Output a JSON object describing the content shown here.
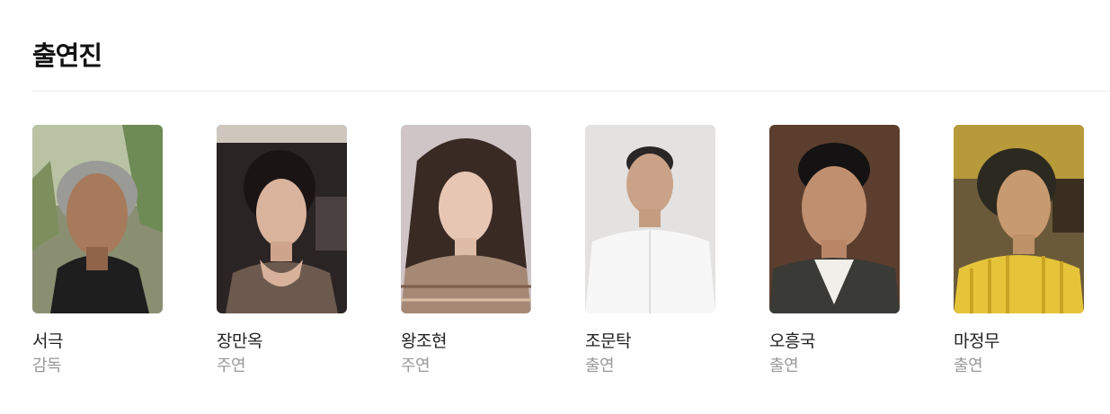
{
  "section": {
    "title": "출연진"
  },
  "cast": [
    {
      "name": "서극",
      "role": "감독",
      "photo_icon": "person-portrait-icon"
    },
    {
      "name": "장만옥",
      "role": "주연",
      "photo_icon": "person-portrait-icon"
    },
    {
      "name": "왕조현",
      "role": "주연",
      "photo_icon": "person-portrait-icon"
    },
    {
      "name": "조문탁",
      "role": "출연",
      "photo_icon": "person-portrait-icon"
    },
    {
      "name": "오흥국",
      "role": "출연",
      "photo_icon": "person-portrait-icon"
    },
    {
      "name": "마정무",
      "role": "출연",
      "photo_icon": "person-portrait-icon"
    }
  ],
  "colors": {
    "title": "#111111",
    "name": "#222222",
    "role": "#999999",
    "divider": "#ececec"
  }
}
